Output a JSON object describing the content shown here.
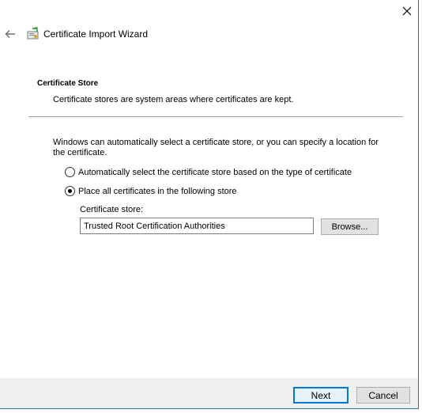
{
  "window": {
    "title": "Certificate Import Wizard",
    "close_icon": "close-icon",
    "back_icon": "back-arrow-icon",
    "title_icon": "certificate-wizard-icon"
  },
  "header": {
    "section_title": "Certificate Store",
    "section_description": "Certificate stores are system areas where certificates are kept."
  },
  "body": {
    "intro": "Windows can automatically select a certificate store, or you can specify a location for the certificate.",
    "options": [
      {
        "label": "Automatically select the certificate store based on the type of certificate",
        "selected": false
      },
      {
        "label": "Place all certificates in the following store",
        "selected": true
      }
    ],
    "store_label": "Certificate store:",
    "store_value": "Trusted Root Certification Authorities",
    "browse_label": "Browse..."
  },
  "footer": {
    "next_label": "Next",
    "cancel_label": "Cancel"
  },
  "colors": {
    "accent": "#0078d7",
    "footer_bg": "#f0f0f0",
    "window_border": "#2b6aa8"
  }
}
